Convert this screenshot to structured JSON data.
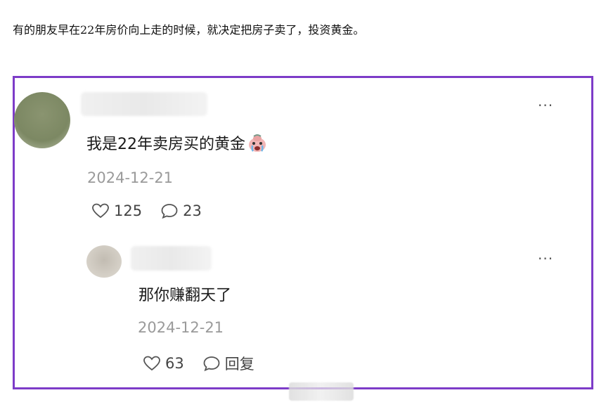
{
  "headline": "有的朋友早在22年房价向上走的时候，就决定把房子卖了，投资黄金。",
  "colors": {
    "frame_border": "#7d3cc8",
    "text": "#1a1a1a",
    "date": "#9a9a9a"
  },
  "comment": {
    "text": "我是22年卖房买的黄金",
    "emoji": "crying-face-emoji",
    "date": "2024-12-21",
    "likes": "125",
    "replies": "23",
    "more": "···"
  },
  "reply": {
    "text": "那你赚翻天了",
    "date": "2024-12-21",
    "likes": "63",
    "reply_label": "回复",
    "more": "···"
  }
}
